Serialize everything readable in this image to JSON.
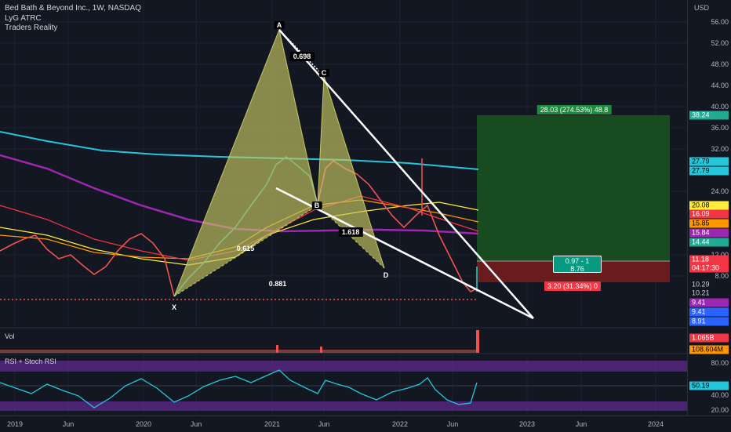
{
  "header": {
    "symbol_title": "Bed Bath & Beyond Inc., 1W, NASDAQ",
    "indicator_1": "LyG ATRC",
    "indicator_2": "Traders Reality"
  },
  "price_axis": {
    "currency": "USD",
    "ticks": [
      "56.00",
      "52.00",
      "48.00",
      "44.00",
      "40.00",
      "36.00",
      "32.00",
      "24.00",
      "12.00",
      "8.00"
    ],
    "tags": [
      {
        "text": "38.24",
        "bg": "#22ab94",
        "fg": "#ffffff"
      },
      {
        "text": "27.79",
        "bg": "#26c6da",
        "fg": "#000000"
      },
      {
        "text": "27.79",
        "bg": "#26c6da",
        "fg": "#000000"
      },
      {
        "text": "20.08",
        "bg": "#ffeb3b",
        "fg": "#000000"
      },
      {
        "text": "16.09",
        "bg": "#f23645",
        "fg": "#ffffff"
      },
      {
        "text": "15.85",
        "bg": "#ff9800",
        "fg": "#000000"
      },
      {
        "text": "15.84",
        "bg": "#9c27b0",
        "fg": "#ffffff"
      },
      {
        "text": "14.44",
        "bg": "#22ab94",
        "fg": "#ffffff"
      },
      {
        "text": "11.18",
        "bg": "#f23645",
        "fg": "#ffffff"
      },
      {
        "text": "04:17:30",
        "bg": "#f23645",
        "fg": "#ffffff"
      },
      {
        "text": "10.29",
        "bg": "#131722",
        "fg": "#d1d4dc"
      },
      {
        "text": "10.21",
        "bg": "#131722",
        "fg": "#d1d4dc"
      },
      {
        "text": "9.41",
        "bg": "#9c27b0",
        "fg": "#ffffff"
      },
      {
        "text": "9.41",
        "bg": "#2962ff",
        "fg": "#ffffff"
      },
      {
        "text": "8.91",
        "bg": "#2962ff",
        "fg": "#ffffff"
      }
    ]
  },
  "volume": {
    "title": "Vol",
    "tags": [
      {
        "text": "1.065B",
        "bg": "#f23645",
        "fg": "#ffffff"
      },
      {
        "text": "108.604M",
        "bg": "#ff9800",
        "fg": "#000000"
      }
    ]
  },
  "rsi": {
    "title": "RSI + Stoch RSI",
    "ticks": [
      "80.00",
      "40.00",
      "20.00"
    ],
    "tags": [
      {
        "text": "50.19",
        "bg": "#26c6da",
        "fg": "#000000"
      }
    ]
  },
  "time_axis": {
    "labels": [
      "2019",
      "Jun",
      "2020",
      "Jun",
      "2021",
      "Jun",
      "2022",
      "Jun",
      "2023",
      "Jun",
      "2024"
    ]
  },
  "pattern": {
    "points": [
      "X",
      "A",
      "B",
      "C",
      "D"
    ],
    "ratios": [
      "0.698",
      "0.615",
      "1.618",
      "0.881"
    ]
  },
  "position": {
    "target_label": "28.03 (274.53%) 48.8",
    "entry_label_line1": "0.97 - 1",
    "entry_label_line2": "8.76",
    "stop_label": "3.20 (31.34%) 0"
  },
  "colors": {
    "background": "#131722",
    "harmonic_fill": "#c8c864",
    "profit_zone": "#1b5e20",
    "loss_zone": "#7f1d1d",
    "ma_cyan": "#26c6da",
    "ma_purple": "#9c27b0"
  }
}
